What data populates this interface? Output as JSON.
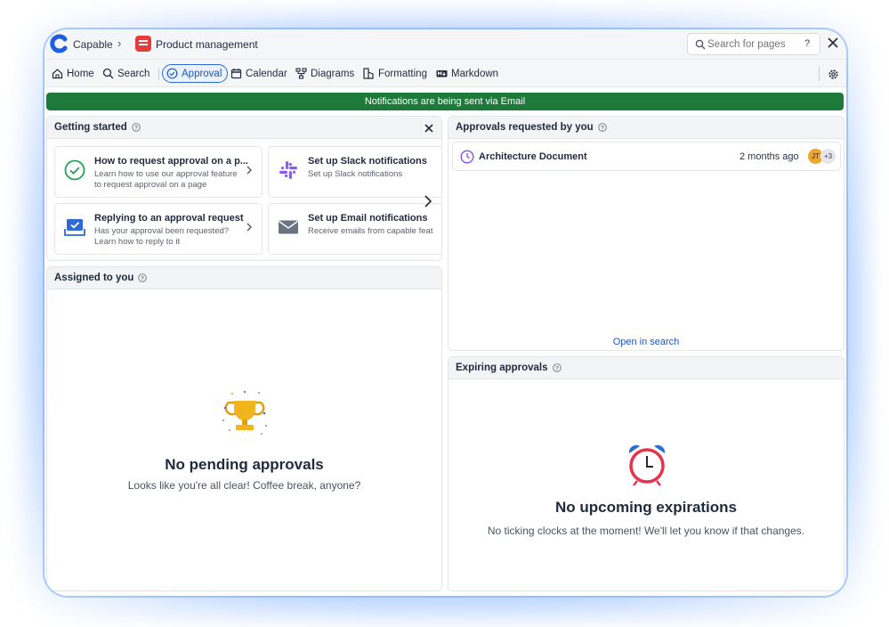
{
  "titlebar": {
    "app_name": "Capable",
    "page_name": "Product management",
    "search_placeholder": "Search for pages",
    "search_help": "?"
  },
  "nav": {
    "home": "Home",
    "search": "Search",
    "approval": "Approval",
    "calendar": "Calendar",
    "diagrams": "Diagrams",
    "formatting": "Formatting",
    "markdown": "Markdown"
  },
  "banner": {
    "text": "Notifications are being sent via Email"
  },
  "getting_started": {
    "title": "Getting started",
    "cards": [
      {
        "title": "How to request approval on a p...",
        "desc": "Learn how to use our approval feature to request approval on a page",
        "icon": "check-circle-icon"
      },
      {
        "title": "Set up Slack notifications",
        "desc": "Set up Slack notifications",
        "icon": "slack-icon"
      },
      {
        "title": "Replying to an approval request",
        "desc": "Has your approval been requested? Learn how to reply to it",
        "icon": "inbox-check-icon"
      },
      {
        "title": "Set up Email notifications",
        "desc": "Receive emails from capable feat",
        "icon": "mail-icon"
      }
    ]
  },
  "assigned": {
    "title": "Assigned to you",
    "empty_title": "No pending approvals",
    "empty_desc": "Looks like you're all clear! Coffee break, anyone?"
  },
  "requested": {
    "title": "Approvals requested by you",
    "rows": [
      {
        "name": "Architecture Document",
        "time": "2 months ago",
        "avatar": "JT",
        "more": "+3"
      }
    ],
    "open_link": "Open in search"
  },
  "expiring": {
    "title": "Expiring approvals",
    "empty_title": "No upcoming expirations",
    "empty_desc": "No ticking clocks at the moment! We'll let you know if that changes."
  },
  "colors": {
    "accent": "#2d6ad6",
    "banner": "#1d7a3a",
    "purple": "#8b5cf6"
  }
}
